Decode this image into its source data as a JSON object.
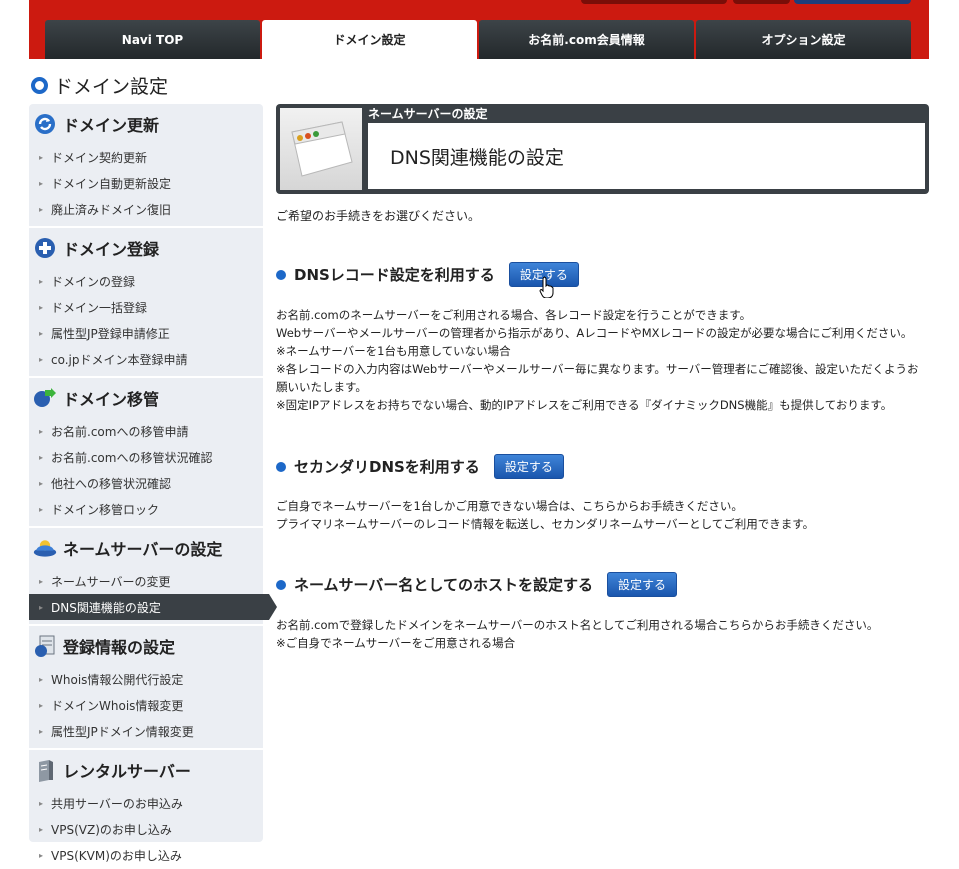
{
  "tabs": [
    {
      "label": "Navi TOP",
      "active": false
    },
    {
      "label": "ドメイン設定",
      "active": true
    },
    {
      "label": "お名前.com会員情報",
      "active": false
    },
    {
      "label": "オプション設定",
      "active": false
    }
  ],
  "page_title": "ドメイン設定",
  "sidebar": [
    {
      "title": "ドメイン更新",
      "icon": "refresh-icon",
      "items": [
        "ドメイン契約更新",
        "ドメイン自動更新設定",
        "廃止済みドメイン復旧"
      ]
    },
    {
      "title": "ドメイン登録",
      "icon": "plus-icon",
      "items": [
        "ドメインの登録",
        "ドメイン一括登録",
        "属性型JP登録申請修正",
        "co.jpドメイン本登録申請"
      ]
    },
    {
      "title": "ドメイン移管",
      "icon": "transfer-icon",
      "items": [
        "お名前.comへの移管申請",
        "お名前.comへの移管状況確認",
        "他社への移管状況確認",
        "ドメイン移管ロック"
      ]
    },
    {
      "title": "ネームサーバーの設定",
      "icon": "nameserver-icon",
      "items": [
        "ネームサーバーの変更",
        "DNS関連機能の設定"
      ],
      "active_index": 1
    },
    {
      "title": "登録情報の設定",
      "icon": "document-icon",
      "items": [
        "Whois情報公開代行設定",
        "ドメインWhois情報変更",
        "属性型JPドメイン情報変更"
      ]
    },
    {
      "title": "レンタルサーバー",
      "icon": "server-icon",
      "items": [
        "共用サーバーのお申込み",
        "VPS(VZ)のお申し込み",
        "VPS(KVM)のお申し込み"
      ]
    }
  ],
  "panel": {
    "label": "ネームサーバーの設定",
    "title": "DNS関連機能の設定"
  },
  "intro": "ご希望のお手続きをお選びください。",
  "sections": [
    {
      "title": "DNSレコード設定を利用する",
      "button": "設定する",
      "lines": [
        "お名前.comのネームサーバーをご利用される場合、各レコード設定を行うことができます。",
        "Webサーバーやメールサーバーの管理者から指示があり、AレコードやMXレコードの設定が必要な場合にご利用ください。",
        "※ネームサーバーを1台も用意していない場合",
        "※各レコードの入力内容はWebサーバーやメールサーバー毎に異なります。サーバー管理者にご確認後、設定いただくようお願いいたします。",
        "※固定IPアドレスをお持ちでない場合、動的IPアドレスをご利用できる『ダイナミックDNS機能』も提供しております。"
      ]
    },
    {
      "title": "セカンダリDNSを利用する",
      "button": "設定する",
      "lines": [
        "ご自身でネームサーバーを1台しかご用意できない場合は、こちらからお手続きください。",
        "プライマリネームサーバーのレコード情報を転送し、セカンダリネームサーバーとしてご利用できます。"
      ]
    },
    {
      "title": "ネームサーバー名としてのホストを設定する",
      "button": "設定する",
      "lines": [
        "お名前.comで登録したドメインをネームサーバーのホスト名としてご利用される場合こちらからお手続きください。",
        "※ご自身でネームサーバーをご用意される場合"
      ]
    }
  ],
  "colors": {
    "header_red": "#cc1a10",
    "tab_dark": "#2c3235",
    "accent_blue": "#1d68c8",
    "sidebar_bg": "#ebeef3"
  }
}
